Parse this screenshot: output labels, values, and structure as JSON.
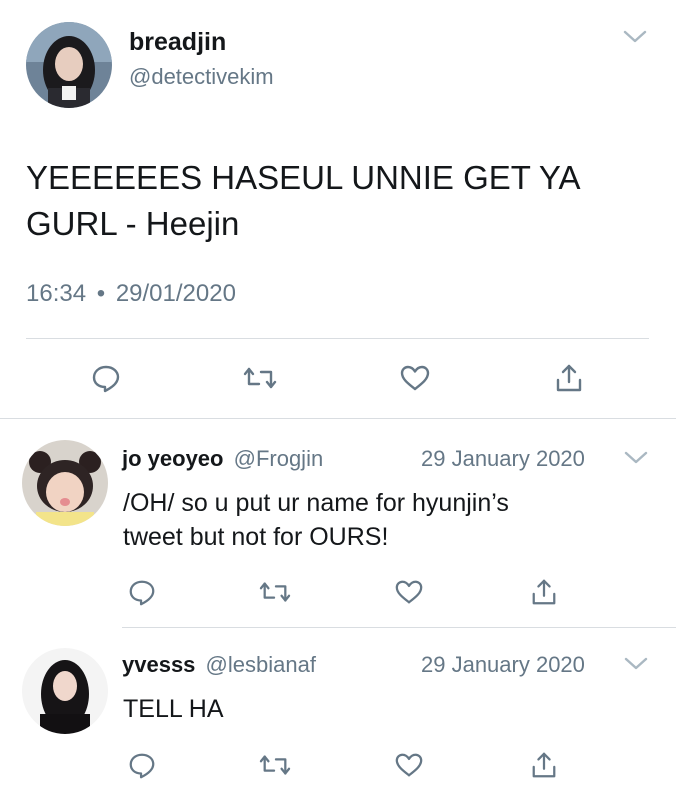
{
  "colors": {
    "text": "#14171a",
    "secondary": "#657786",
    "divider": "#d9dde1",
    "chevron": "#aab8c2"
  },
  "main_tweet": {
    "author_name": "breadjin",
    "handle": "@detectivekim",
    "text_line1": "YEEEEEES HASEUL UNNIE GET YA",
    "text_line2": "GURL - Heejin",
    "time": "16:34",
    "separator": "•",
    "date": "29/01/2020",
    "actions": [
      "reply-icon",
      "retweet-icon",
      "like-icon",
      "share-icon"
    ]
  },
  "replies": [
    {
      "author_name": "jo yeoyeo",
      "handle": "@Frogjin",
      "date": "29 January 2020",
      "text_line1": "/OH/ so u put ur name for hyunjin’s",
      "text_line2": "tweet but not for OURS!"
    },
    {
      "author_name": "yvesss",
      "handle": "@lesbianaf",
      "date": "29 January 2020",
      "text_line1": "TELL HA"
    }
  ]
}
